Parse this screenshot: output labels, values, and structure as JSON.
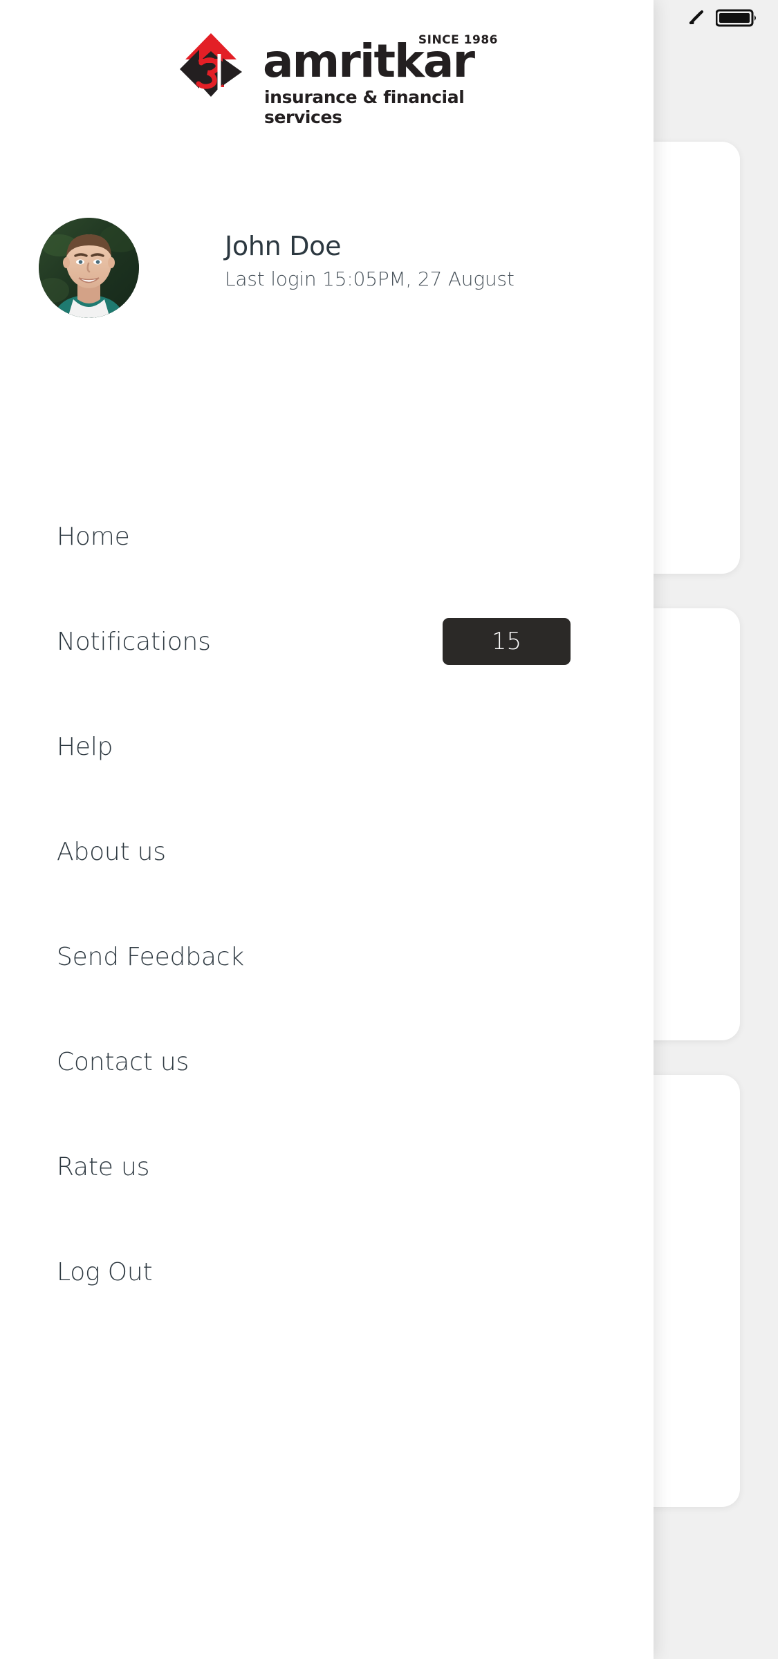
{
  "statusbar": {
    "wifi_icon": "wifi-icon",
    "battery_icon": "battery-icon"
  },
  "header": {
    "logo_mark_icon": "amritkar-logo-mark-icon",
    "wordmark": "amritkar",
    "since": "SINCE 1986",
    "tagline": "insurance & financial services",
    "bell_icon": "bell-icon",
    "bell_has_unread": true
  },
  "profile": {
    "avatar_icon": "user-avatar-photo",
    "name": "John Doe",
    "last_login": "Last login 15:05PM, 27 August"
  },
  "menu": {
    "items": [
      {
        "label": "Home",
        "badge": null
      },
      {
        "label": "Notifications",
        "badge": "15"
      },
      {
        "label": "Help",
        "badge": null
      },
      {
        "label": "About us",
        "badge": null
      },
      {
        "label": "Send Feedback",
        "badge": null
      },
      {
        "label": "Contact us",
        "badge": null
      },
      {
        "label": "Rate us",
        "badge": null
      },
      {
        "label": "Log Out",
        "badge": null
      }
    ]
  },
  "colors": {
    "brand_red": "#e31f26",
    "brand_dark": "#231f20",
    "text": "#2f3a42",
    "badge_bg": "#2b2927",
    "drawer_bg": "#ffffff",
    "page_bg": "#f0f0f0"
  }
}
